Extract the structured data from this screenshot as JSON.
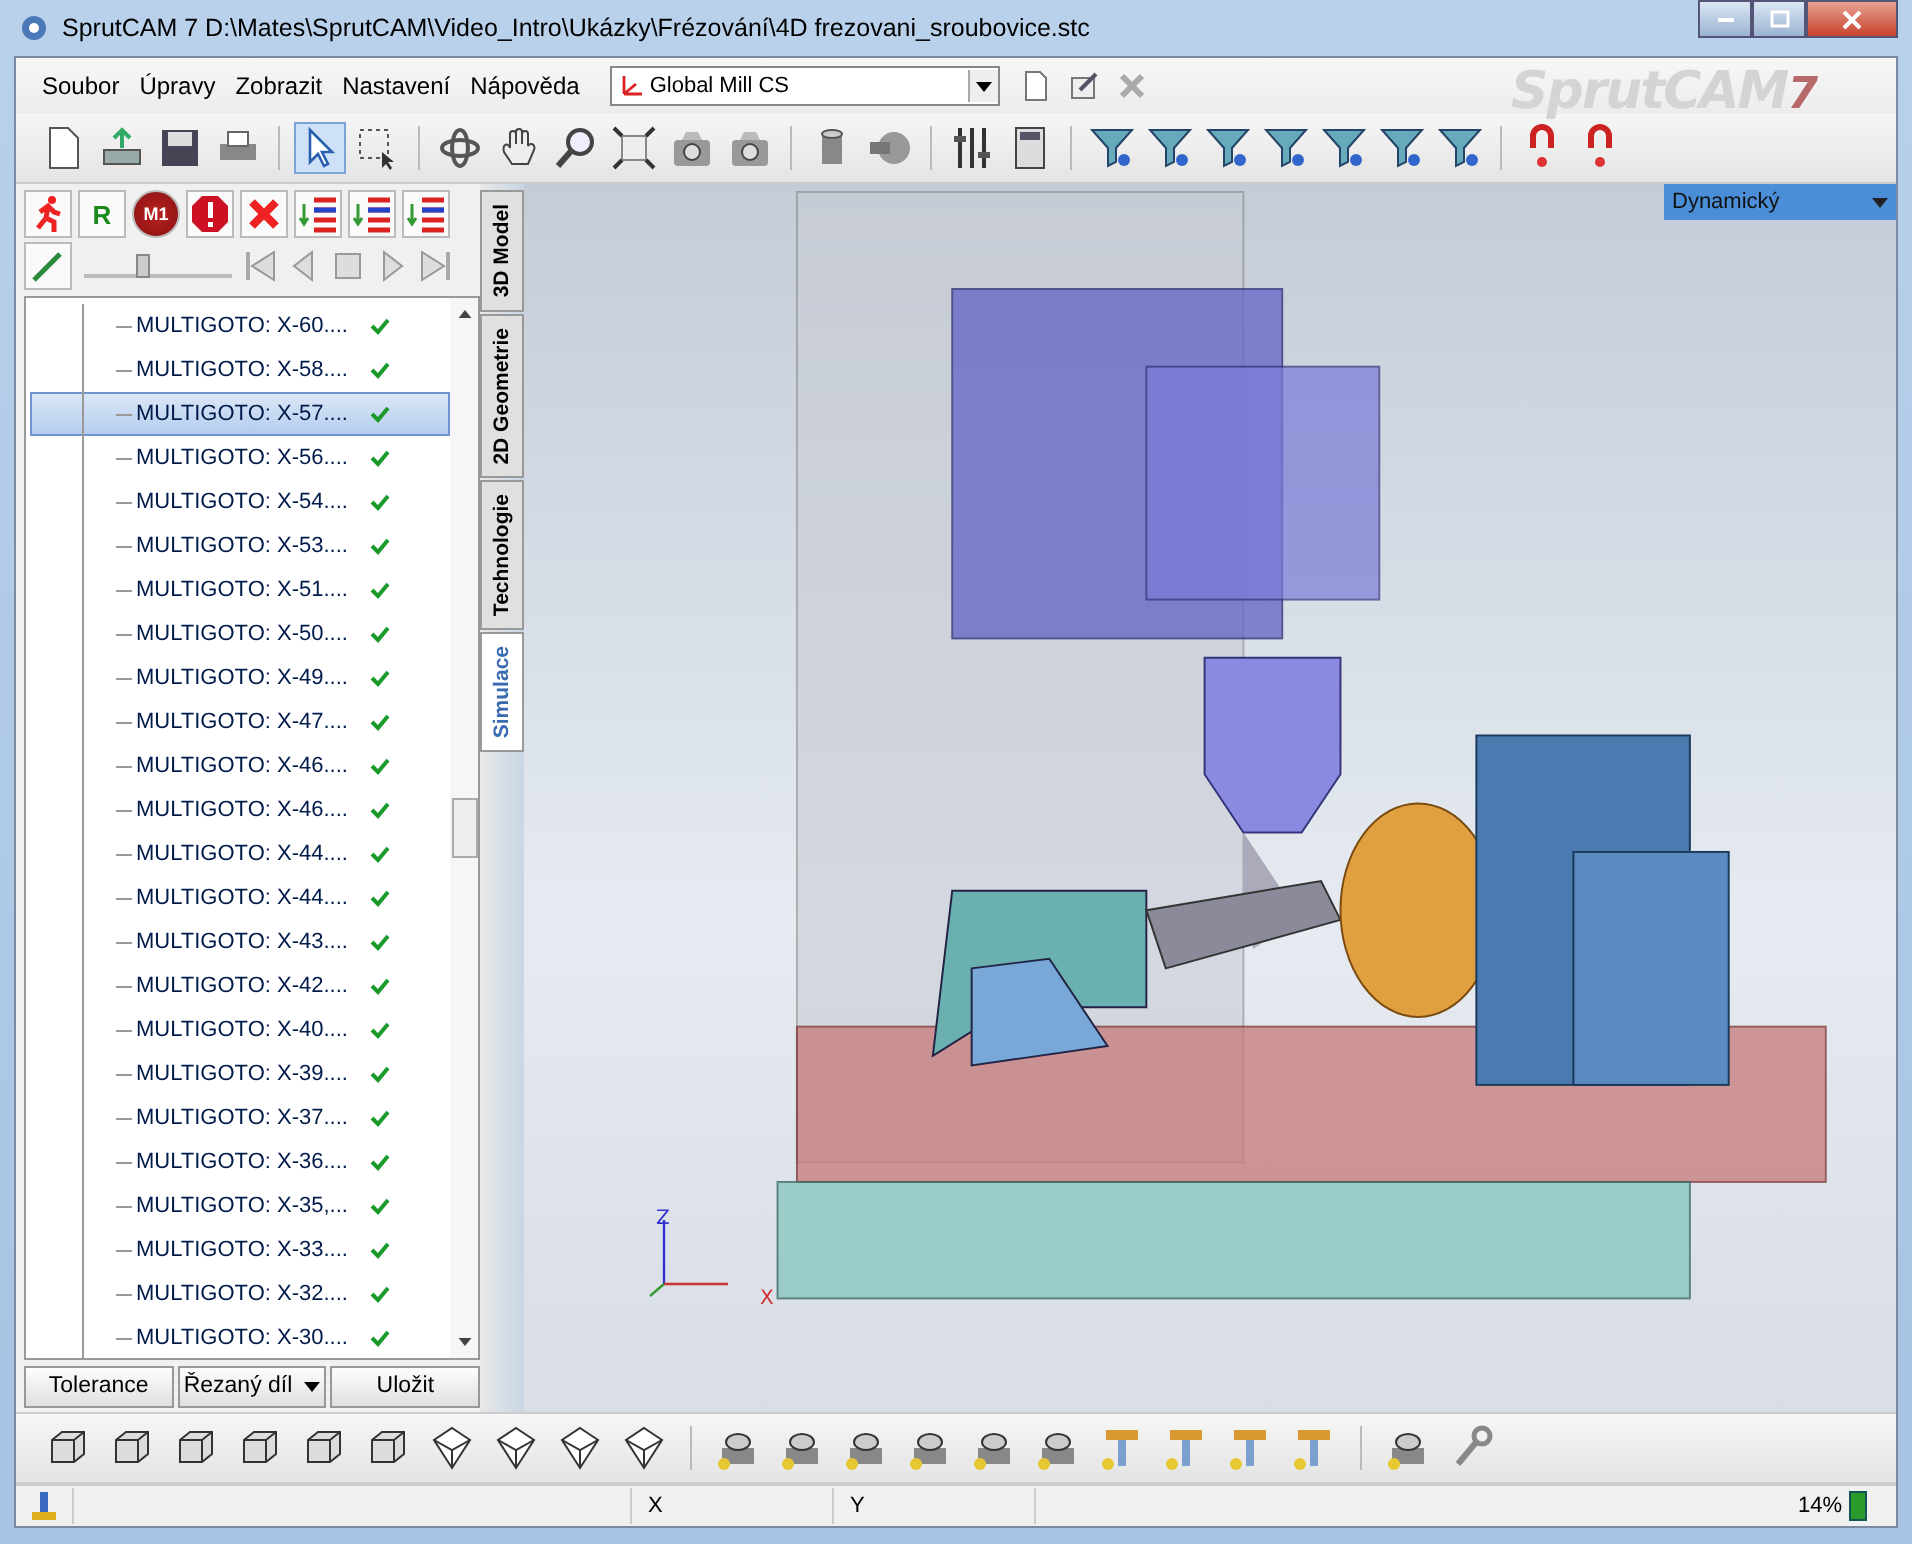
{
  "window": {
    "title": "SprutCAM 7   D:\\Mates\\SprutCAM\\Video_Intro\\Ukázky\\Frézování\\4D frezovani_sroubovice.stc"
  },
  "menu": [
    "Soubor",
    "Úpravy",
    "Zobrazit",
    "Nastavení",
    "Nápověda"
  ],
  "coordinate_system": {
    "value": "Global Mill CS"
  },
  "logo": {
    "text": "SprutCAM",
    "version": "7"
  },
  "left_toolbar": {
    "r_label": "R",
    "m1_label": "M1"
  },
  "speed": {
    "level": 0.35
  },
  "side_tabs": [
    {
      "label": "3D Model",
      "selected": false
    },
    {
      "label": "2D Geometrie",
      "selected": false
    },
    {
      "label": "Technologie",
      "selected": false
    },
    {
      "label": "Simulace",
      "selected": true
    }
  ],
  "tree_rows": [
    {
      "text": "MULTIGOTO: X-60....",
      "done": true,
      "selected": false
    },
    {
      "text": "MULTIGOTO: X-58....",
      "done": true,
      "selected": false
    },
    {
      "text": "MULTIGOTO: X-57....",
      "done": true,
      "selected": true
    },
    {
      "text": "MULTIGOTO: X-56....",
      "done": true,
      "selected": false
    },
    {
      "text": "MULTIGOTO: X-54....",
      "done": true,
      "selected": false
    },
    {
      "text": "MULTIGOTO: X-53....",
      "done": true,
      "selected": false
    },
    {
      "text": "MULTIGOTO: X-51....",
      "done": true,
      "selected": false
    },
    {
      "text": "MULTIGOTO: X-50....",
      "done": true,
      "selected": false
    },
    {
      "text": "MULTIGOTO: X-49....",
      "done": true,
      "selected": false
    },
    {
      "text": "MULTIGOTO: X-47....",
      "done": true,
      "selected": false
    },
    {
      "text": "MULTIGOTO: X-46....",
      "done": true,
      "selected": false
    },
    {
      "text": "MULTIGOTO: X-46....",
      "done": true,
      "selected": false
    },
    {
      "text": "MULTIGOTO: X-44....",
      "done": true,
      "selected": false
    },
    {
      "text": "MULTIGOTO: X-44....",
      "done": true,
      "selected": false
    },
    {
      "text": "MULTIGOTO: X-43....",
      "done": true,
      "selected": false
    },
    {
      "text": "MULTIGOTO: X-42....",
      "done": true,
      "selected": false
    },
    {
      "text": "MULTIGOTO: X-40....",
      "done": true,
      "selected": false
    },
    {
      "text": "MULTIGOTO: X-39....",
      "done": true,
      "selected": false
    },
    {
      "text": "MULTIGOTO: X-37....",
      "done": true,
      "selected": false
    },
    {
      "text": "MULTIGOTO: X-36....",
      "done": true,
      "selected": false
    },
    {
      "text": "MULTIGOTO: X-35,...",
      "done": true,
      "selected": false
    },
    {
      "text": "MULTIGOTO: X-33....",
      "done": true,
      "selected": false
    },
    {
      "text": "MULTIGOTO: X-32....",
      "done": true,
      "selected": false
    },
    {
      "text": "MULTIGOTO: X-30....",
      "done": true,
      "selected": false
    }
  ],
  "panel_buttons": [
    {
      "label": "Tolerance",
      "kind": "plain"
    },
    {
      "label": "Řezaný díl",
      "kind": "dropdown"
    },
    {
      "label": "Uložit",
      "kind": "plain"
    }
  ],
  "view_mode": {
    "value": "Dynamický"
  },
  "axes": {
    "x": "X",
    "z": "Z"
  },
  "status_bar": {
    "x_label": "X",
    "y_label": "Y",
    "zoom": "14%"
  }
}
